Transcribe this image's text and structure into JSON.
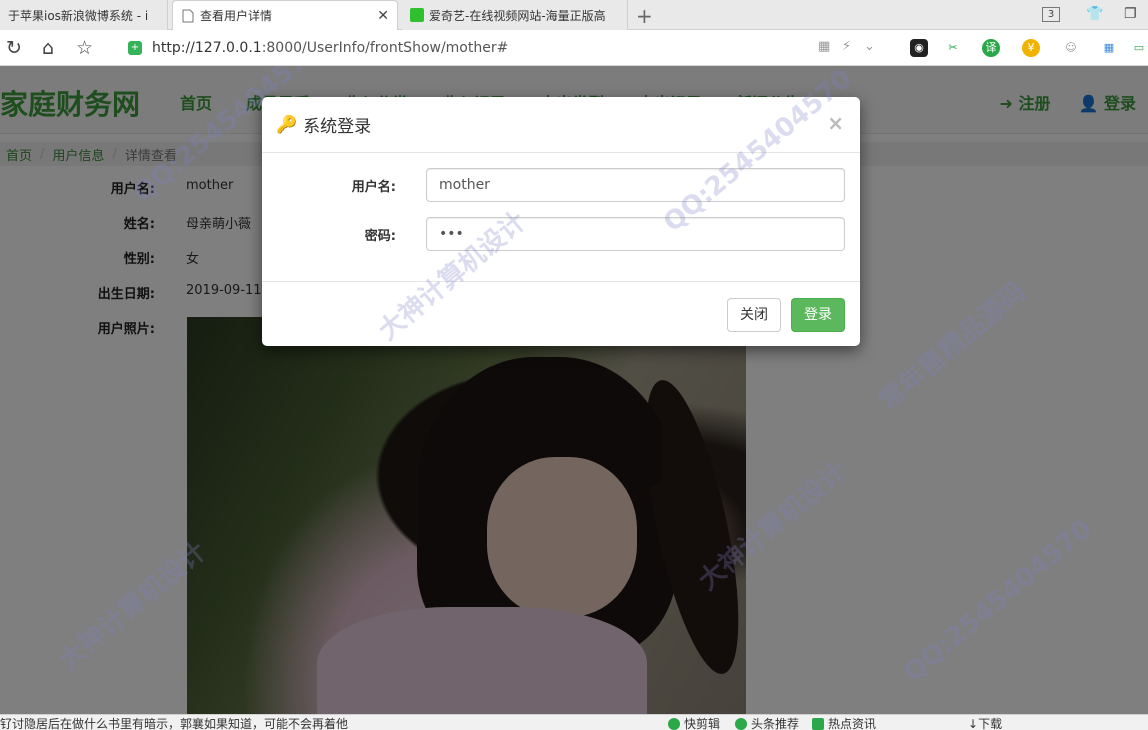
{
  "browser": {
    "tabs": [
      {
        "title": "于苹果ios新浪微博系统 - i",
        "active": false
      },
      {
        "title": "查看用户详情",
        "active": true
      },
      {
        "title": "爱奇艺-在线视频网站-海量正版高",
        "active": false
      }
    ],
    "tab_count": "3",
    "url_host": "http://127.0.0.1",
    "url_path": ":8000/UserInfo/frontShow/mother#"
  },
  "site": {
    "brand": "家庭财务网",
    "nav": [
      "首页",
      "成员风采",
      "收入分类",
      "收入记录",
      "支出类型",
      "支出记录",
      "新闻公告"
    ],
    "register": "注册",
    "login": "登录"
  },
  "breadcrumb": {
    "home": "首页",
    "section": "用户信息",
    "current": "详情查看"
  },
  "user_detail": {
    "username_label": "用户名:",
    "username": "mother",
    "name_label": "姓名:",
    "name": "母亲萌小薇",
    "gender_label": "性别:",
    "gender": "女",
    "birth_label": "出生日期:",
    "birth": "2019-09-11",
    "photo_label": "用户照片:"
  },
  "login_modal": {
    "title": "系统登录",
    "close_x": "×",
    "username_label": "用户名:",
    "username_value": "mother",
    "password_label": "密码:",
    "password_value": "•••",
    "close_button": "关闭",
    "login_button": "登录"
  },
  "statusbar": {
    "news": "钌讨隐居后在做什么书里有暗示，郭襄如果知道，可能不会再着他",
    "items": [
      "快剪辑",
      "头条推荐",
      "热点资讯",
      "下载"
    ]
  },
  "watermark": {
    "texts": [
      "大神计算机设计",
      "QQ:2545404570",
      "常年售精品源码"
    ]
  },
  "colors": {
    "brand_green": "#3c9a3c",
    "button_green": "#5cb85c"
  }
}
